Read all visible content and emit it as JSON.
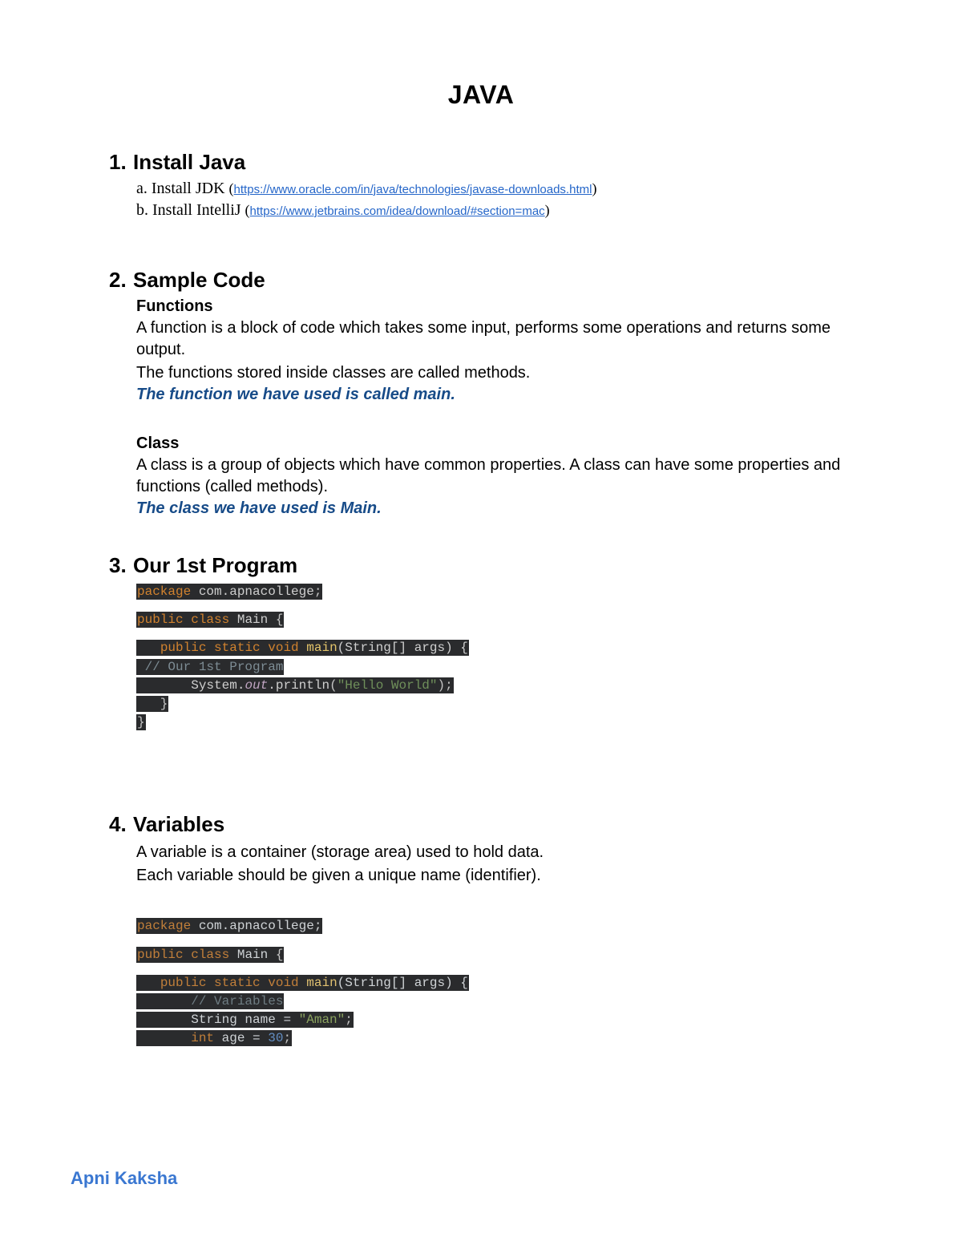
{
  "title": "JAVA",
  "footer": "Apni Kaksha",
  "s1": {
    "num": "1.",
    "heading": "Install Java",
    "a": {
      "prefix": "a. Install JDK ",
      "l": "(",
      "url": "https://www.oracle.com/in/java/technologies/javase-downloads.html",
      "r": ")"
    },
    "b": {
      "prefix": "b. Install IntelliJ ",
      "l": "(",
      "url": "https://www.jetbrains.com/idea/download/#section=mac",
      "r": ")"
    }
  },
  "s2": {
    "num": "2.",
    "heading": "Sample Code",
    "func_h": "Functions",
    "func_p1": "A function is a block of code which takes some input, performs some operations and returns some output.",
    "func_p2": "The functions stored inside classes are called methods.",
    "func_em": "The function we have used is called main.",
    "class_h": "Class",
    "class_p1": "A class is a group of objects which have common properties. A class can have some properties and functions (called methods).",
    "class_em": "The class we have used is Main."
  },
  "s3": {
    "num": "3.",
    "heading": "Our 1st Program",
    "code": {
      "l1": {
        "kw": "package",
        "rest": " com.apnacollege",
        "end": ";"
      },
      "l2": {
        "kw1": "public",
        "kw2": "class",
        "id": " Main ",
        "brace": "{"
      },
      "l3": {
        "kw1": "public",
        "kw2": "static",
        "kw3": "void",
        "fn": "main",
        "sig": "(String[] args) {"
      },
      "l4": {
        "cm": " // Our 1st Program"
      },
      "l5": {
        "ind": "       ",
        "cls": "System.",
        "out": "out",
        "dot": ".",
        "meth": "println",
        "op": "(",
        "str": "\"Hello World\"",
        "cl": ")",
        "sc": ";"
      },
      "l6": {
        "end": "   }"
      },
      "l7": {
        "end": "}"
      }
    }
  },
  "s4": {
    "num": "4.",
    "heading": "Variables",
    "p1": "A variable is a container (storage area) used to hold data.",
    "p2": "Each variable should be given a unique name (identifier).",
    "code": {
      "l1": {
        "kw": "package",
        "rest": " com.apnacollege;"
      },
      "l2": {
        "kw1": "public",
        "kw2": "class",
        "id": " Main ",
        "brace": "{"
      },
      "l3": {
        "kw1": "public",
        "kw2": "static",
        "kw3": "void",
        "fn": "main",
        "sig": "(String[] args) {"
      },
      "l4": {
        "ind": "       ",
        "cm": "// Variables"
      },
      "l5": {
        "ind": "       ",
        "ty": "String",
        "rest": " name = ",
        "str": "\"Aman\"",
        "sc": ";"
      },
      "l6": {
        "ind": "       ",
        "ty": "int",
        "rest": " age = ",
        "num": "30",
        "sc": ";"
      }
    }
  }
}
